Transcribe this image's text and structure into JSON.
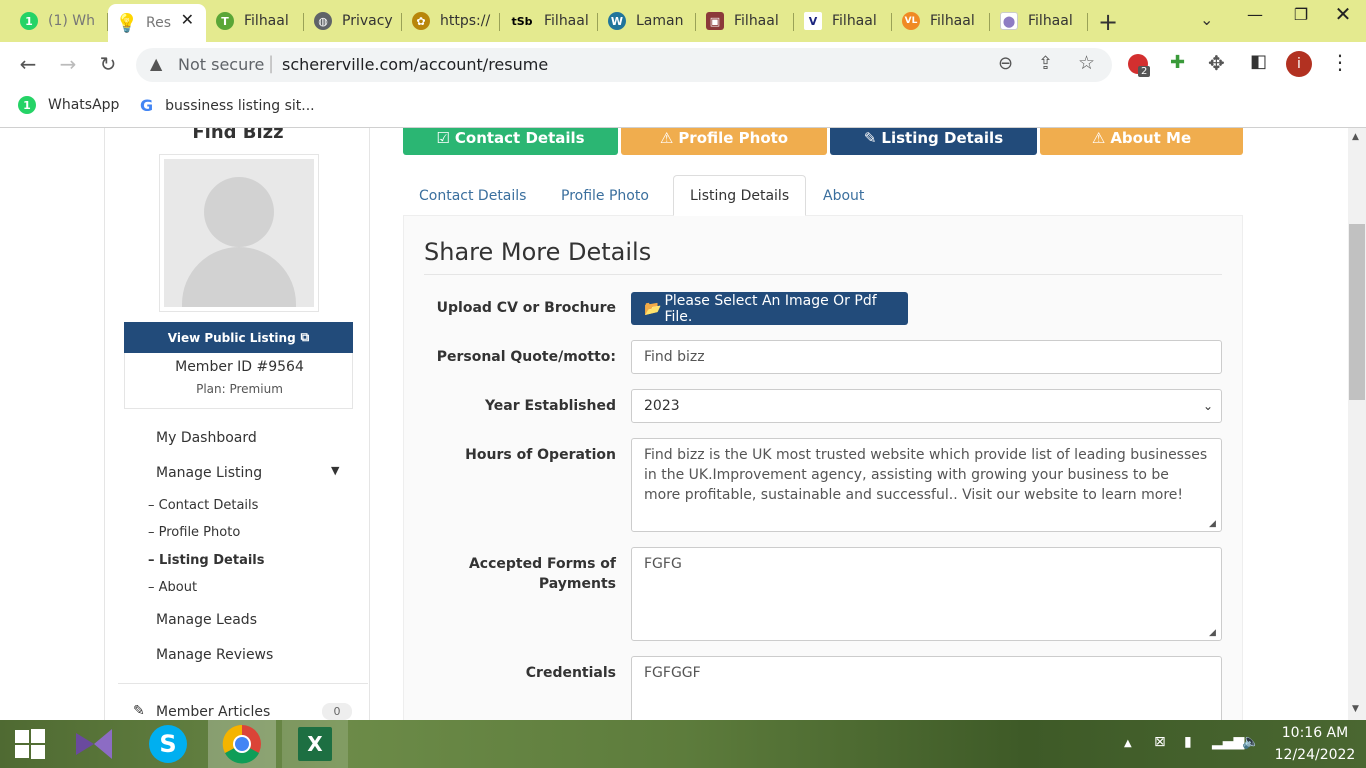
{
  "browser": {
    "tabs": [
      {
        "label": "(1) Wh",
        "icon": "whatsapp-icon",
        "color": "#25d366",
        "glyph": "1"
      },
      {
        "label": "Res",
        "icon": "lightbulb-icon",
        "color": "#f5c518",
        "glyph": "",
        "active": true
      },
      {
        "label": "Filhaal",
        "icon": "t-logo-icon",
        "color": "#5aa637",
        "glyph": "T"
      },
      {
        "label": "Privacy",
        "icon": "globe-icon",
        "color": "#5f6368",
        "glyph": ""
      },
      {
        "label": "https://",
        "icon": "bee-icon",
        "color": "#b8860b",
        "glyph": ""
      },
      {
        "label": "Filhaal",
        "icon": "tsb-icon",
        "color": "#000000",
        "glyph": "tSb"
      },
      {
        "label": "Laman",
        "icon": "wordpress-icon",
        "color": "#21759b",
        "glyph": "W"
      },
      {
        "label": "Filhaal",
        "icon": "dashboard-icon",
        "color": "#8b3a3a",
        "glyph": ""
      },
      {
        "label": "Filhaal",
        "icon": "v-logo-icon",
        "color": "#1a237e",
        "glyph": "V"
      },
      {
        "label": "Filhaal",
        "icon": "vl-icon",
        "color": "#f08a24",
        "glyph": "VL"
      },
      {
        "label": "Filhaal",
        "icon": "pin-icon",
        "color": "#8e7cc3",
        "glyph": ""
      }
    ],
    "security_label": "Not secure",
    "url": "schererville.com/account/resume",
    "extension_badge": "2",
    "profile_initial": "i",
    "bookmarks": [
      {
        "label": "WhatsApp",
        "icon": "whatsapp-icon"
      },
      {
        "label": "bussiness listing sit...",
        "icon": "google-icon"
      }
    ]
  },
  "sidebar": {
    "business_name": "Find Bizz",
    "public_listing_label": "View Public Listing",
    "member_id": "Member ID #9564",
    "plan": "Plan: Premium",
    "links": [
      {
        "label": "My Dashboard"
      },
      {
        "label": "Manage Listing"
      }
    ],
    "subitems": [
      {
        "label": "– Contact Details"
      },
      {
        "label": "– Profile Photo"
      },
      {
        "label": "– Listing Details",
        "active": true
      },
      {
        "label": "– About"
      }
    ],
    "links2": [
      {
        "label": "Manage Leads"
      },
      {
        "label": "Manage Reviews"
      }
    ],
    "articles": {
      "label": "Member Articles",
      "count": "0"
    }
  },
  "steps": [
    {
      "label": "Contact Details",
      "icon": "checkbox-icon",
      "color": "#2bb673"
    },
    {
      "label": "Profile Photo",
      "icon": "warning-icon",
      "color": "#f0ad4e"
    },
    {
      "label": "Listing Details",
      "icon": "pencil-icon",
      "color": "#224b7a"
    },
    {
      "label": "About Me",
      "icon": "warning-icon",
      "color": "#f0ad4e"
    }
  ],
  "tabs": [
    {
      "label": "Contact Details"
    },
    {
      "label": "Profile Photo"
    },
    {
      "label": "Listing Details",
      "active": true
    },
    {
      "label": "About"
    }
  ],
  "form": {
    "heading": "Share More Details",
    "upload": {
      "label": "Upload CV or Brochure",
      "button": "Please Select An Image Or Pdf File."
    },
    "quote": {
      "label": "Personal Quote/motto:",
      "value": "Find bizz"
    },
    "year": {
      "label": "Year Established",
      "value": "2023"
    },
    "hours": {
      "label": "Hours of Operation",
      "value": "Find bizz is the UK most trusted website which provide list of leading businesses in the UK.Improvement agency, assisting with growing your business to be more profitable, sustainable and successful.. Visit our website to learn more!"
    },
    "payments": {
      "label_line1": "Accepted Forms of",
      "label_line2": "Payments",
      "value": "FGFG"
    },
    "credentials": {
      "label": "Credentials",
      "value": "FGFGGF"
    }
  },
  "taskbar": {
    "time": "10:16 AM",
    "date": "12/24/2022",
    "apps": [
      "windows-start-icon",
      "visual-studio-icon",
      "skype-icon",
      "chrome-icon",
      "excel-icon"
    ]
  },
  "colors": {
    "primary_dark": "#224b7a",
    "link_blue": "#3a6f9e",
    "success": "#2bb673",
    "warning": "#f0ad4e"
  }
}
